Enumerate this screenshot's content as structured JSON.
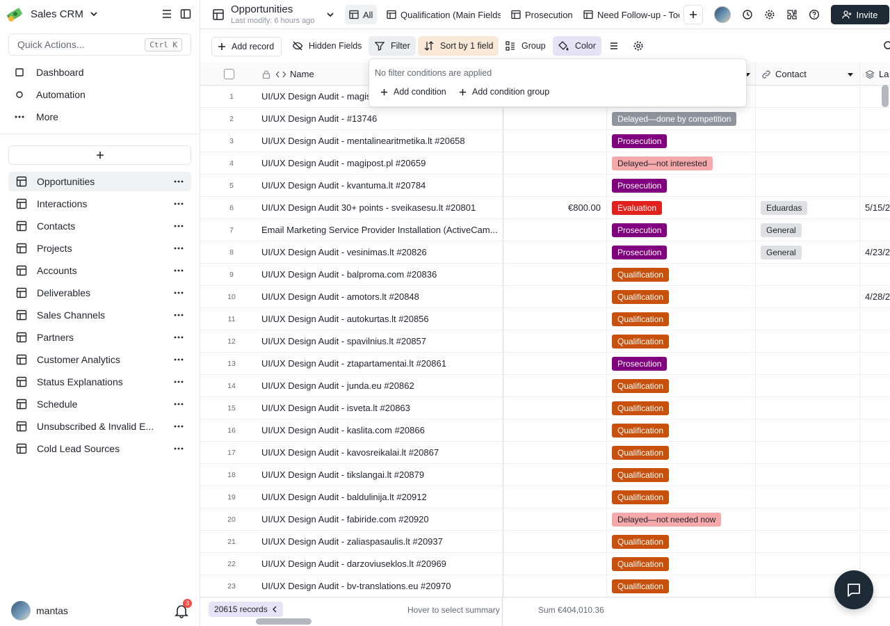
{
  "app": {
    "name": "Sales CRM",
    "logo_icon": "money-stack-icon"
  },
  "quick_actions": {
    "label": "Quick Actions...",
    "shortcut": "Ctrl K"
  },
  "nav": [
    {
      "label": "Dashboard",
      "icon": "dashboard-icon"
    },
    {
      "label": "Automation",
      "icon": "automation-icon"
    },
    {
      "label": "More",
      "icon": "more-icon"
    }
  ],
  "tables": [
    {
      "label": "Opportunities",
      "active": true
    },
    {
      "label": "Interactions"
    },
    {
      "label": "Contacts"
    },
    {
      "label": "Projects"
    },
    {
      "label": "Accounts"
    },
    {
      "label": "Deliverables"
    },
    {
      "label": "Sales Channels"
    },
    {
      "label": "Partners"
    },
    {
      "label": "Customer Analytics"
    },
    {
      "label": "Status Explanations"
    },
    {
      "label": "Schedule"
    },
    {
      "label": "Unsubscribed & Invalid E..."
    },
    {
      "label": "Cold Lead Sources"
    }
  ],
  "user": {
    "name": "mantas",
    "notifications": "3"
  },
  "header": {
    "title": "Opportunities",
    "subtitle": "Last modify: 6 hours ago",
    "views": [
      {
        "label": "All",
        "active": true
      },
      {
        "label": "Qualification (Main Fields)"
      },
      {
        "label": "Prosecution"
      },
      {
        "label": "Need Follow-up - Toda"
      }
    ],
    "invite_label": "Invite"
  },
  "toolbar": {
    "add_record": "Add record",
    "hidden_fields": "Hidden Fields",
    "filter": "Filter",
    "sort": "Sort by 1 field",
    "group": "Group",
    "color": "Color"
  },
  "filter_popover": {
    "message": "No filter conditions are applied",
    "add_condition": "Add condition",
    "add_condition_group": "Add condition group"
  },
  "columns": {
    "name": "Name",
    "contact": "Contact",
    "last": "La"
  },
  "status_colors": {
    "Prosecution": {
      "bg": "#800080",
      "fg": "#ffffff"
    },
    "Qualification": {
      "bg": "#c8500a",
      "fg": "#ffffff"
    },
    "Evaluation": {
      "bg": "#e0211c",
      "fg": "#ffffff"
    },
    "Delayed—not interested": {
      "bg": "#f6a9ab",
      "fg": "#1f2329"
    },
    "Delayed—not needed now": {
      "bg": "#f6a9ab",
      "fg": "#1f2329"
    },
    "Delayed—done by competition": {
      "bg": "#8f959e",
      "fg": "#ffffff"
    }
  },
  "rows": [
    {
      "num": "1",
      "name": "UI/UX Design Audit - magis",
      "amount": "",
      "status": "",
      "contact": "",
      "last": ""
    },
    {
      "num": "2",
      "name": "UI/UX Design Audit -  #13746",
      "amount": "",
      "status": "Delayed—done by competition",
      "contact": "",
      "last": ""
    },
    {
      "num": "3",
      "name": "UI/UX Design Audit - mentalinearitmetika.lt #20658",
      "amount": "",
      "status": "Prosecution",
      "contact": "",
      "last": ""
    },
    {
      "num": "4",
      "name": "UI/UX Design Audit - magipost.pl #20659",
      "amount": "",
      "status": "Delayed—not interested",
      "contact": "",
      "last": ""
    },
    {
      "num": "5",
      "name": "UI/UX Design Audit - kvantuma.lt #20784",
      "amount": "",
      "status": "Prosecution",
      "contact": "",
      "last": ""
    },
    {
      "num": "6",
      "name": "UI/UX Design Audit 30+ points - sveikasesu.lt #20801",
      "amount": "€800.00",
      "status": "Evaluation",
      "contact": "Eduardas",
      "last": "5/15/2"
    },
    {
      "num": "7",
      "name": "Email Marketing Service Provider Installation (ActiveCam...",
      "amount": "",
      "status": "Prosecution",
      "contact": "General",
      "last": ""
    },
    {
      "num": "8",
      "name": "UI/UX Design Audit - vesinimas.lt #20826",
      "amount": "",
      "status": "Prosecution",
      "contact": "General",
      "last": "4/23/2"
    },
    {
      "num": "9",
      "name": "UI/UX Design Audit - balproma.com #20836",
      "amount": "",
      "status": "Qualification",
      "contact": "",
      "last": ""
    },
    {
      "num": "10",
      "name": "UI/UX Design Audit - amotors.lt #20848",
      "amount": "",
      "status": "Qualification",
      "contact": "",
      "last": "4/28/2"
    },
    {
      "num": "11",
      "name": "UI/UX Design Audit - autokurtas.lt #20856",
      "amount": "",
      "status": "Qualification",
      "contact": "",
      "last": ""
    },
    {
      "num": "12",
      "name": "UI/UX Design Audit - spavilnius.lt #20857",
      "amount": "",
      "status": "Qualification",
      "contact": "",
      "last": ""
    },
    {
      "num": "13",
      "name": "UI/UX Design Audit - ztapartamentai.lt #20861",
      "amount": "",
      "status": "Prosecution",
      "contact": "",
      "last": ""
    },
    {
      "num": "14",
      "name": "UI/UX Design Audit - junda.eu #20862",
      "amount": "",
      "status": "Qualification",
      "contact": "",
      "last": ""
    },
    {
      "num": "15",
      "name": "UI/UX Design Audit - isveta.lt #20863",
      "amount": "",
      "status": "Qualification",
      "contact": "",
      "last": ""
    },
    {
      "num": "16",
      "name": "UI/UX Design Audit - kaslita.com #20866",
      "amount": "",
      "status": "Qualification",
      "contact": "",
      "last": ""
    },
    {
      "num": "17",
      "name": "UI/UX Design Audit - kavosreikalai.lt #20867",
      "amount": "",
      "status": "Qualification",
      "contact": "",
      "last": ""
    },
    {
      "num": "18",
      "name": "UI/UX Design Audit - tikslangai.lt #20879",
      "amount": "",
      "status": "Qualification",
      "contact": "",
      "last": ""
    },
    {
      "num": "19",
      "name": "UI/UX Design Audit - baldulinija.lt #20912",
      "amount": "",
      "status": "Qualification",
      "contact": "",
      "last": ""
    },
    {
      "num": "20",
      "name": "UI/UX Design Audit - fabiride.com #20920",
      "amount": "",
      "status": "Delayed—not needed now",
      "contact": "",
      "last": ""
    },
    {
      "num": "21",
      "name": "UI/UX Design Audit - zaliaspasaulis.lt #20937",
      "amount": "",
      "status": "Qualification",
      "contact": "",
      "last": ""
    },
    {
      "num": "22",
      "name": "UI/UX Design Audit - darzoviuseklos.lt #20969",
      "amount": "",
      "status": "Qualification",
      "contact": "",
      "last": ""
    },
    {
      "num": "23",
      "name": "UI/UX Design Audit - bv-translations.eu #20970",
      "amount": "",
      "status": "Qualification",
      "contact": "",
      "last": ""
    }
  ],
  "footer": {
    "records": "20615 records",
    "hover_summary": "Hover to select summary",
    "sum": "Sum €404,010.36"
  }
}
